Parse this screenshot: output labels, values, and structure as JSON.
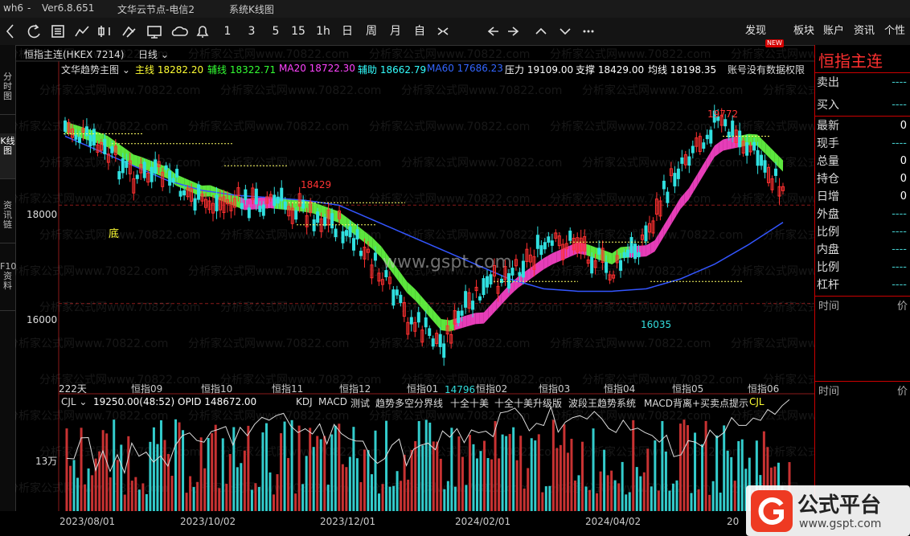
{
  "titlebar": {
    "app": "wh6",
    "sep": "-",
    "version": "Ver6.8.651",
    "node": "文华云节点-电信2",
    "window": "系统K线图"
  },
  "toolbar": {
    "nums": [
      "1",
      "3",
      "5",
      "15",
      "1h",
      "日",
      "周",
      "月",
      "自"
    ],
    "right": [
      "发现",
      "板块",
      "账户",
      "资讯",
      "个性"
    ],
    "badge": "NEW"
  },
  "sidebar": [
    "分时图",
    "K线图",
    "资讯链",
    "F10资料"
  ],
  "chart": {
    "contract": "恒指主连(HKEX 7214)",
    "period": "日线",
    "indicator_menu": "文华趋势主图",
    "lines": [
      {
        "label": "主线",
        "value": "18282.20",
        "color": "#ffff33"
      },
      {
        "label": "辅线",
        "value": "18322.71",
        "color": "#33ff33"
      },
      {
        "label": "MA20",
        "value": "18722.30",
        "color": "#ff44ff"
      },
      {
        "label": "辅助",
        "value": "18662.79",
        "color": "#33ffff"
      },
      {
        "label": "MA60",
        "value": "17686.23",
        "color": "#3366ff"
      },
      {
        "label": "压力",
        "value": "19109.00",
        "color": "#ffffff"
      },
      {
        "label": "支撑",
        "value": "18429.00",
        "color": "#ffffff"
      },
      {
        "label": "均线",
        "value": "18198.35",
        "color": "#ffffff"
      }
    ],
    "notice": "账号没有数据权限",
    "yticks": [
      "18000",
      "16000"
    ],
    "annotations": {
      "peak1": "18429",
      "peak2": "19772",
      "low1": "14796",
      "low2": "16035",
      "bottom": "底",
      "days": "222天"
    },
    "month_labels": [
      "恒指09",
      "恒指10",
      "恒指11",
      "恒指12",
      "恒指01",
      "恒指02",
      "恒指03",
      "恒指04",
      "恒指05",
      "恒指06"
    ],
    "watermark": "www.gspt.com"
  },
  "sub": {
    "name": "CJL",
    "info": "19250.00(48:52)  OPID 148672.00",
    "tabs": [
      "KDJ",
      "MACD",
      "测试",
      "趋势多空分界线",
      "十全十美",
      "十全十美升级版",
      "波段王趋势系统",
      "MACD背离+买卖点提示",
      "CJL"
    ],
    "ytick": "13万",
    "dates": [
      "2023/08/01",
      "2023/10/02",
      "2023/12/01",
      "2024/02/01",
      "2024/04/02",
      "20"
    ]
  },
  "right_panel": {
    "title": "恒指主连",
    "rows": [
      {
        "label": "卖出",
        "value": "----"
      },
      {
        "label": "买入",
        "value": "----"
      },
      {
        "label": "最新",
        "value": "0"
      },
      {
        "label": "现手",
        "value": "----"
      },
      {
        "label": "总量",
        "value": "0"
      },
      {
        "label": "持仓",
        "value": "0"
      },
      {
        "label": "日增",
        "value": "0"
      },
      {
        "label": "外盘",
        "value": "----"
      },
      {
        "label": "比例",
        "value": "----"
      },
      {
        "label": "内盘",
        "value": "----"
      },
      {
        "label": "比例",
        "value": "----"
      },
      {
        "label": "杠杆",
        "value": "----"
      }
    ],
    "tick_headers": [
      "时间",
      "价"
    ]
  },
  "logo": {
    "text": "公式平台",
    "url": "www.gspt.com"
  },
  "colors": {
    "up": "#ff3030",
    "down": "#30e0e0",
    "grid": "#8b1a1a",
    "support": "#ffff66"
  },
  "watermark_text": "分析家公式网www.70822.com",
  "chart_data": {
    "type": "candlestick",
    "range": {
      "x": [
        "2023/08/01",
        "2024/06"
      ],
      "y": [
        14796,
        19772
      ]
    },
    "ylim": [
      14200,
      20600
    ],
    "highlights": [
      {
        "label": "18429"
      },
      {
        "label": "19772"
      },
      {
        "label": "14796"
      },
      {
        "label": "16035"
      }
    ],
    "series": [
      {
        "name": "MA60",
        "values": [
          19400,
          19100,
          18800,
          18500,
          18300,
          18200,
          18150,
          18100,
          18000,
          17700,
          17400,
          17100,
          16800,
          16500,
          16300,
          16250,
          16250,
          16300,
          16500,
          16800,
          17200,
          17650
        ]
      },
      {
        "name": "主线",
        "values": [
          19600,
          19150,
          18600,
          18600,
          18000,
          18050,
          18100,
          17900,
          17600,
          16800,
          15700,
          15200,
          16100,
          16700,
          17100,
          17300,
          16600,
          17400,
          18900,
          19700,
          19200,
          18300
        ]
      }
    ]
  }
}
